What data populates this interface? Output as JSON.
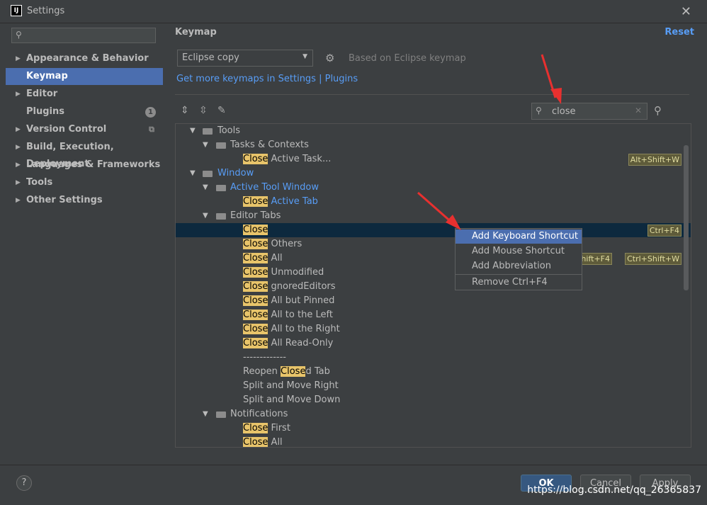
{
  "window": {
    "logo": "IJ",
    "title": "Settings",
    "close_glyph": "✕"
  },
  "sidebar": {
    "search_placeholder": "",
    "items": [
      {
        "label": "Appearance & Behavior",
        "expandable": true
      },
      {
        "label": "Keymap",
        "selected": true
      },
      {
        "label": "Editor",
        "expandable": true
      },
      {
        "label": "Plugins",
        "badge": "1"
      },
      {
        "label": "Version Control",
        "expandable": true
      },
      {
        "label": "Build, Execution, Deployment",
        "expandable": true
      },
      {
        "label": "Languages & Frameworks",
        "expandable": true
      },
      {
        "label": "Tools",
        "expandable": true
      },
      {
        "label": "Other Settings",
        "expandable": true
      }
    ]
  },
  "main": {
    "title": "Keymap",
    "reset": "Reset",
    "keymap_select": "Eclipse copy",
    "based_on": "Based on Eclipse keymap",
    "more_keymaps": "Get more keymaps in Settings | Plugins",
    "search_value": "close"
  },
  "tree": [
    {
      "pre": "",
      "hl": "",
      "post": "Tools",
      "level": 0,
      "folder": true
    },
    {
      "pre": "",
      "hl": "",
      "post": "Tasks & Contexts",
      "level": 1,
      "folder": true
    },
    {
      "pre": "",
      "hl": "Close",
      "post": " Active Task...",
      "level": 2,
      "shortcuts": [
        "Alt+Shift+W"
      ]
    },
    {
      "pre": "",
      "hl": "",
      "post": "Window",
      "level": 0,
      "folder": true,
      "blue": true
    },
    {
      "pre": "",
      "hl": "",
      "post": "Active Tool Window",
      "level": 1,
      "folder": true,
      "blue": true
    },
    {
      "pre": "",
      "hl": "Close",
      "post": " Active Tab",
      "level": 2,
      "blue": true
    },
    {
      "pre": "",
      "hl": "",
      "post": "Editor Tabs",
      "level": 1,
      "folder": true
    },
    {
      "pre": "",
      "hl": "Close",
      "post": "",
      "level": 2,
      "selected": true,
      "shortcuts": [
        "Ctrl+F4"
      ]
    },
    {
      "pre": "",
      "hl": "Close",
      "post": " Others",
      "level": 2
    },
    {
      "pre": "",
      "hl": "Close",
      "post": " All",
      "level": 2,
      "shortcuts": [
        "+Shift+F4",
        "Ctrl+Shift+W"
      ]
    },
    {
      "pre": "",
      "hl": "Close",
      "post": " Unmodified",
      "level": 2
    },
    {
      "pre": "",
      "hl": "Close",
      "post": " gnoredEditors",
      "level": 2
    },
    {
      "pre": "",
      "hl": "Close",
      "post": " All but Pinned",
      "level": 2
    },
    {
      "pre": "",
      "hl": "Close",
      "post": " All to the Left",
      "level": 2
    },
    {
      "pre": "",
      "hl": "Close",
      "post": " All to the Right",
      "level": 2
    },
    {
      "pre": "",
      "hl": "Close",
      "post": " All Read-Only",
      "level": 2
    },
    {
      "pre": "",
      "hl": "",
      "post": "-------------",
      "level": 2
    },
    {
      "pre": "Reopen ",
      "hl": "Close",
      "post": "d Tab",
      "level": 2
    },
    {
      "pre": "",
      "hl": "",
      "post": "Split and Move Right",
      "level": 2
    },
    {
      "pre": "",
      "hl": "",
      "post": "Split and Move Down",
      "level": 2
    },
    {
      "pre": "",
      "hl": "",
      "post": "Notifications",
      "level": 1,
      "folder": true
    },
    {
      "pre": "",
      "hl": "Close",
      "post": " First",
      "level": 2
    },
    {
      "pre": "",
      "hl": "Close",
      "post": " All",
      "level": 2
    }
  ],
  "context_menu": {
    "add_keyboard": "Add Keyboard Shortcut",
    "add_mouse": "Add Mouse Shortcut",
    "add_abbreviation": "Add Abbreviation",
    "remove": "Remove Ctrl+F4"
  },
  "footer": {
    "help": "?",
    "ok": "OK",
    "cancel": "Cancel",
    "apply": "Apply",
    "watermark": "https://blog.csdn.net/qq_26365837"
  },
  "colors": {
    "accent": "#4b6eaf",
    "link": "#589df6",
    "highlight": "#e8c46a",
    "annotation_arrow": "#e8302f"
  }
}
